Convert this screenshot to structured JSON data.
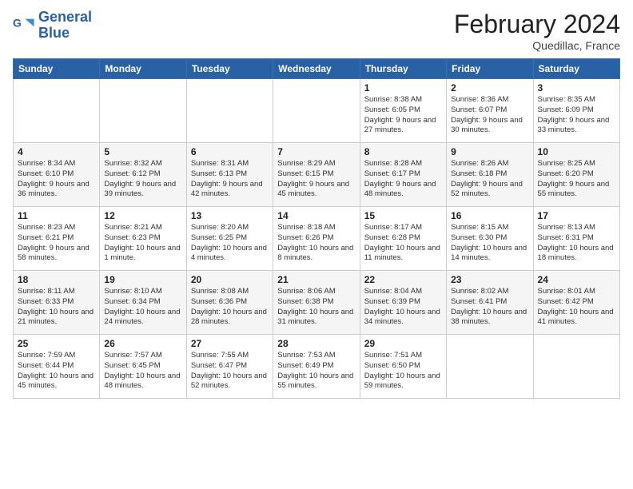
{
  "header": {
    "logo_line1": "General",
    "logo_line2": "Blue",
    "month_title": "February 2024",
    "location": "Quedillac, France"
  },
  "days_of_week": [
    "Sunday",
    "Monday",
    "Tuesday",
    "Wednesday",
    "Thursday",
    "Friday",
    "Saturday"
  ],
  "weeks": [
    [
      {
        "day": "",
        "info": ""
      },
      {
        "day": "",
        "info": ""
      },
      {
        "day": "",
        "info": ""
      },
      {
        "day": "",
        "info": ""
      },
      {
        "day": "1",
        "info": "Sunrise: 8:38 AM\nSunset: 6:05 PM\nDaylight: 9 hours and 27 minutes."
      },
      {
        "day": "2",
        "info": "Sunrise: 8:36 AM\nSunset: 6:07 PM\nDaylight: 9 hours and 30 minutes."
      },
      {
        "day": "3",
        "info": "Sunrise: 8:35 AM\nSunset: 6:09 PM\nDaylight: 9 hours and 33 minutes."
      }
    ],
    [
      {
        "day": "4",
        "info": "Sunrise: 8:34 AM\nSunset: 6:10 PM\nDaylight: 9 hours and 36 minutes."
      },
      {
        "day": "5",
        "info": "Sunrise: 8:32 AM\nSunset: 6:12 PM\nDaylight: 9 hours and 39 minutes."
      },
      {
        "day": "6",
        "info": "Sunrise: 8:31 AM\nSunset: 6:13 PM\nDaylight: 9 hours and 42 minutes."
      },
      {
        "day": "7",
        "info": "Sunrise: 8:29 AM\nSunset: 6:15 PM\nDaylight: 9 hours and 45 minutes."
      },
      {
        "day": "8",
        "info": "Sunrise: 8:28 AM\nSunset: 6:17 PM\nDaylight: 9 hours and 48 minutes."
      },
      {
        "day": "9",
        "info": "Sunrise: 8:26 AM\nSunset: 6:18 PM\nDaylight: 9 hours and 52 minutes."
      },
      {
        "day": "10",
        "info": "Sunrise: 8:25 AM\nSunset: 6:20 PM\nDaylight: 9 hours and 55 minutes."
      }
    ],
    [
      {
        "day": "11",
        "info": "Sunrise: 8:23 AM\nSunset: 6:21 PM\nDaylight: 9 hours and 58 minutes."
      },
      {
        "day": "12",
        "info": "Sunrise: 8:21 AM\nSunset: 6:23 PM\nDaylight: 10 hours and 1 minute."
      },
      {
        "day": "13",
        "info": "Sunrise: 8:20 AM\nSunset: 6:25 PM\nDaylight: 10 hours and 4 minutes."
      },
      {
        "day": "14",
        "info": "Sunrise: 8:18 AM\nSunset: 6:26 PM\nDaylight: 10 hours and 8 minutes."
      },
      {
        "day": "15",
        "info": "Sunrise: 8:17 AM\nSunset: 6:28 PM\nDaylight: 10 hours and 11 minutes."
      },
      {
        "day": "16",
        "info": "Sunrise: 8:15 AM\nSunset: 6:30 PM\nDaylight: 10 hours and 14 minutes."
      },
      {
        "day": "17",
        "info": "Sunrise: 8:13 AM\nSunset: 6:31 PM\nDaylight: 10 hours and 18 minutes."
      }
    ],
    [
      {
        "day": "18",
        "info": "Sunrise: 8:11 AM\nSunset: 6:33 PM\nDaylight: 10 hours and 21 minutes."
      },
      {
        "day": "19",
        "info": "Sunrise: 8:10 AM\nSunset: 6:34 PM\nDaylight: 10 hours and 24 minutes."
      },
      {
        "day": "20",
        "info": "Sunrise: 8:08 AM\nSunset: 6:36 PM\nDaylight: 10 hours and 28 minutes."
      },
      {
        "day": "21",
        "info": "Sunrise: 8:06 AM\nSunset: 6:38 PM\nDaylight: 10 hours and 31 minutes."
      },
      {
        "day": "22",
        "info": "Sunrise: 8:04 AM\nSunset: 6:39 PM\nDaylight: 10 hours and 34 minutes."
      },
      {
        "day": "23",
        "info": "Sunrise: 8:02 AM\nSunset: 6:41 PM\nDaylight: 10 hours and 38 minutes."
      },
      {
        "day": "24",
        "info": "Sunrise: 8:01 AM\nSunset: 6:42 PM\nDaylight: 10 hours and 41 minutes."
      }
    ],
    [
      {
        "day": "25",
        "info": "Sunrise: 7:59 AM\nSunset: 6:44 PM\nDaylight: 10 hours and 45 minutes."
      },
      {
        "day": "26",
        "info": "Sunrise: 7:57 AM\nSunset: 6:45 PM\nDaylight: 10 hours and 48 minutes."
      },
      {
        "day": "27",
        "info": "Sunrise: 7:55 AM\nSunset: 6:47 PM\nDaylight: 10 hours and 52 minutes."
      },
      {
        "day": "28",
        "info": "Sunrise: 7:53 AM\nSunset: 6:49 PM\nDaylight: 10 hours and 55 minutes."
      },
      {
        "day": "29",
        "info": "Sunrise: 7:51 AM\nSunset: 6:50 PM\nDaylight: 10 hours and 59 minutes."
      },
      {
        "day": "",
        "info": ""
      },
      {
        "day": "",
        "info": ""
      }
    ]
  ]
}
